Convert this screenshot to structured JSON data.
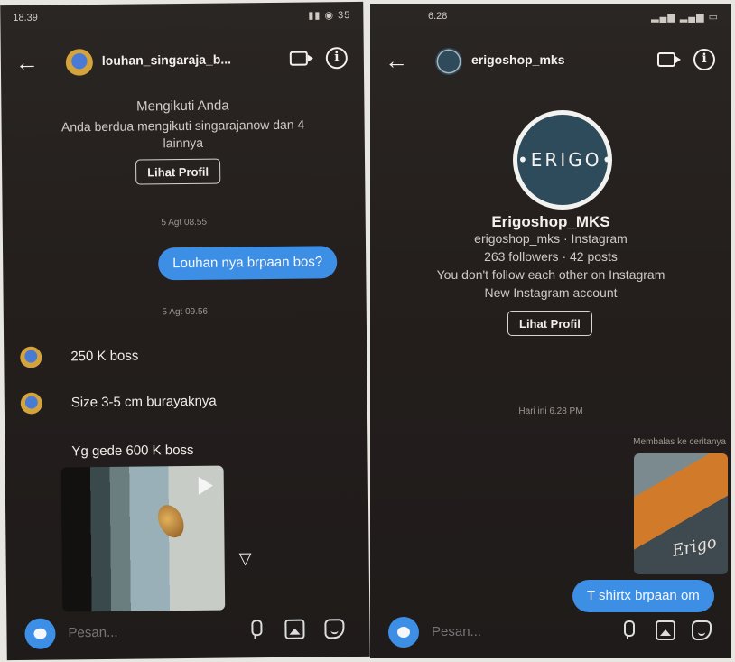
{
  "left": {
    "status": {
      "time": "18.39",
      "icons": "▮▮ ◉ 35"
    },
    "header": {
      "username": "louhan_singaraja_b..."
    },
    "profile": {
      "follows_you": "Mengikuti Anda",
      "mutuals_line1": "Anda berdua mengikuti singarajanow dan 4",
      "mutuals_line2": "lainnya",
      "view_profile": "Lihat Profil"
    },
    "messages": {
      "stamp1": "5 Agt 08.55",
      "outgoing": "Louhan nya brpaan bos?",
      "stamp2": "5 Agt 09.56",
      "in1": "250 K boss",
      "in2": "Size 3-5 cm burayaknya",
      "in3": "Yg gede 600 K boss"
    },
    "composer": {
      "placeholder": "Pesan..."
    }
  },
  "right": {
    "status": {
      "time": "6.28",
      "icons": "▂▄▆ ▂▄▆ ▭"
    },
    "header": {
      "username": "erigoshop_mks"
    },
    "profile": {
      "logo_text": "•ERIGO•",
      "name": "Erigoshop_MKS",
      "handle": "erigoshop_mks · Instagram",
      "stats": "263 followers · 42 posts",
      "follow_status": "You don't follow each other on Instagram",
      "account_note": "New Instagram account",
      "view_profile": "Lihat Profil"
    },
    "messages": {
      "stamp": "Hari ini 6.28 PM",
      "reply_label": "Membalas ke ceritanya",
      "story_text": "Erigo",
      "outgoing": "T shirtx brpaan om"
    },
    "composer": {
      "placeholder": "Pesan..."
    }
  },
  "colors": {
    "accent": "#3d8fe6",
    "background": "#231f1d"
  },
  "icons": [
    "back-arrow-icon",
    "video-call-icon",
    "info-icon",
    "camera-icon",
    "mic-icon",
    "gallery-icon",
    "sticker-icon",
    "share-icon",
    "play-icon"
  ]
}
